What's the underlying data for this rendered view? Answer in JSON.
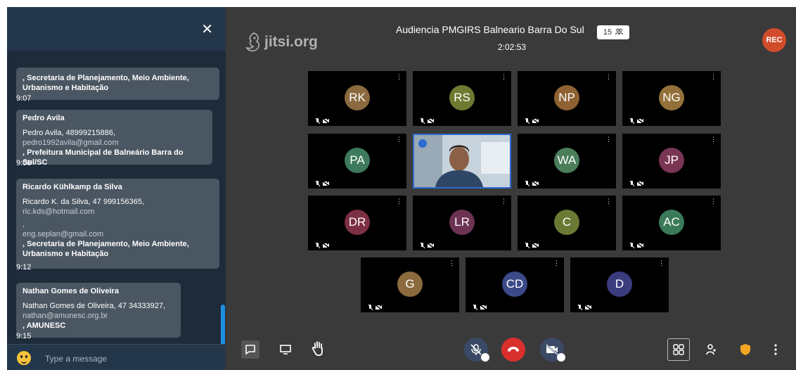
{
  "chat": {
    "close_icon": "✕",
    "messages": [
      {
        "sender": "",
        "lines": [
          ", Secretaria de Planejamento, Meio Ambiente,",
          "Urbanismo e Habitação"
        ],
        "time": "9:07"
      },
      {
        "sender": "Pedro Avila",
        "lines": [
          "Pedro Avila, 48999215886,",
          "pedro1992avila@gmail.com",
          ", Prefeitura Municipal de Balneário Barra do Sul/SC"
        ],
        "time": "9:08"
      },
      {
        "sender": "Ricardo Kühlkamp da Silva",
        "lines": [
          "Ricardo K. da Silva, 47 999156365,",
          "ric.kds@hotmail.com",
          ",",
          "eng.seplan@gmail.com",
          ", Secretaria de Planejamento, Meio Ambiente,",
          "Urbanismo e Habitação"
        ],
        "time": "9:12"
      },
      {
        "sender": "Nathan Gomes de Oliveira",
        "lines": [
          "Nathan Gomes de Oliveira, 47 34333927,",
          "nathan@amunesc.org.br",
          ", AMUNESC"
        ],
        "time": "9:15"
      }
    ],
    "input_placeholder": "Type a message"
  },
  "meeting": {
    "logo_text": "jitsi.org",
    "title": "Audiencia PMGIRS Balneario Barra Do Sul",
    "participant_count": "15",
    "timer": "2:02:53",
    "rec_label": "REC",
    "tiles": [
      {
        "initials": "RK",
        "color": "#8a6a3e"
      },
      {
        "initials": "RS",
        "color": "#6e7a32"
      },
      {
        "initials": "NP",
        "color": "#8e6132"
      },
      {
        "initials": "NG",
        "color": "#93703a"
      },
      {
        "initials": "PA",
        "color": "#3d7a5c"
      },
      {
        "initials": "",
        "video": true
      },
      {
        "initials": "WA",
        "color": "#4b7e5b"
      },
      {
        "initials": "JP",
        "color": "#7a3552"
      },
      {
        "initials": "DR",
        "color": "#7d2f44"
      },
      {
        "initials": "LR",
        "color": "#6d3353"
      },
      {
        "initials": "C",
        "color": "#6a7a34"
      },
      {
        "initials": "AC",
        "color": "#3b7a58"
      },
      {
        "initials": "G",
        "color": "#8b6a3e"
      },
      {
        "initials": "CD",
        "color": "#3c4a8a"
      },
      {
        "initials": "D",
        "color": "#3a3c7e"
      }
    ]
  },
  "toolbar": {
    "icons": [
      "chat-icon",
      "screenshare-icon",
      "raise-hand-icon",
      "microphone-muted-icon",
      "hangup-icon",
      "camera-muted-icon",
      "tile-view-icon",
      "participants-icon",
      "security-shield-icon",
      "more-options-icon"
    ]
  },
  "colors": {
    "chat_bg": "#1e2b3a",
    "bubble_bg": "#4a5662",
    "meeting_bg": "#3a3a3a",
    "hangup": "#d9302c",
    "rec": "#d14c2a",
    "shield": "#f5a623",
    "accent": "#1f8fe0"
  }
}
